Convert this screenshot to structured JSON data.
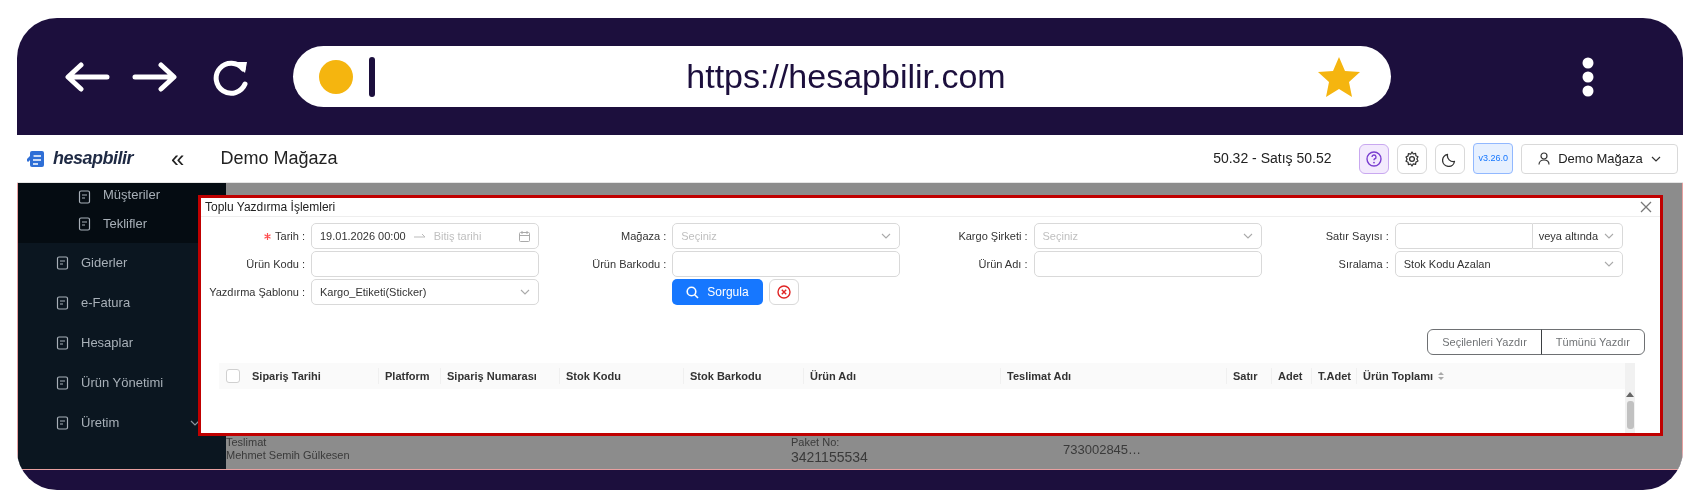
{
  "browser": {
    "url": "https://hesapbilir.com"
  },
  "header": {
    "logo": "hesapbilir",
    "collapse": "«",
    "store": "Demo Mağaza",
    "rate": "50.32 - Satış 50.52",
    "version": "v3.26.0",
    "user": "Demo Mağaza"
  },
  "sidebar": {
    "items": [
      {
        "label": "Müşteriler",
        "kind": "subitem"
      },
      {
        "label": "Teklifler",
        "kind": "subitem"
      },
      {
        "label": "Giderler",
        "kind": "item"
      },
      {
        "label": "e-Fatura",
        "kind": "item"
      },
      {
        "label": "Hesaplar",
        "kind": "item"
      },
      {
        "label": "Ürün Yönetimi",
        "kind": "item"
      },
      {
        "label": "Üretim",
        "kind": "group",
        "expanded": false
      }
    ]
  },
  "background_row": {
    "delivery_label": "Teslimat",
    "delivery_name": "Mehmet Semih Gülkesen",
    "package_label": "Paket No:",
    "package_number": "3421155534",
    "code": "733002845…"
  },
  "modal": {
    "title": "Toplu Yazdırma İşlemleri",
    "fields": [
      {
        "kind": "daterange",
        "label": "Tarih :",
        "required": true,
        "value": "19.01.2026 00:00",
        "end_placeholder": "Bitiş tarihi"
      },
      {
        "kind": "select",
        "label": "Mağaza :",
        "required": false,
        "placeholder": "Seçiniz"
      },
      {
        "kind": "select",
        "label": "Kargo Şirketi :",
        "required": false,
        "placeholder": "Seçiniz"
      },
      {
        "kind": "combo",
        "label": "Satır Sayısı :",
        "required": false,
        "addon": "veya altında"
      },
      {
        "kind": "input",
        "label": "Ürün Kodu :",
        "required": false
      },
      {
        "kind": "input",
        "label": "Ürün Barkodu :",
        "required": false
      },
      {
        "kind": "input",
        "label": "Ürün Adı :",
        "required": false
      },
      {
        "kind": "select",
        "label": "Sıralama :",
        "required": false,
        "value": "Stok Kodu Azalan"
      },
      {
        "kind": "select",
        "label": "Yazdırma Şablonu :",
        "required": false,
        "value": "Kargo_Etiketi(Sticker)"
      },
      {
        "kind": "actions",
        "search": "Sorgula"
      }
    ],
    "print_buttons": [
      {
        "label": "Seçilenleri Yazdır",
        "disabled": true
      },
      {
        "label": "Tümünü Yazdır",
        "disabled": true
      }
    ],
    "table": {
      "select_all": {
        "checked": false
      },
      "columns": [
        {
          "label": "Sipariş Tarihi",
          "sortable": false
        },
        {
          "label": "Platform",
          "sortable": false
        },
        {
          "label": "Sipariş Numarası",
          "sortable": false
        },
        {
          "label": "Stok Kodu",
          "sortable": false
        },
        {
          "label": "Stok Barkodu",
          "sortable": false
        },
        {
          "label": "Ürün Adı",
          "sortable": false
        },
        {
          "label": "Teslimat Adı",
          "sortable": false
        },
        {
          "label": "Satır",
          "sortable": false
        },
        {
          "label": "Adet",
          "sortable": false
        },
        {
          "label": "T.Adet",
          "sortable": false
        },
        {
          "label": "Ürün Toplamı",
          "sortable": true
        }
      ]
    }
  }
}
